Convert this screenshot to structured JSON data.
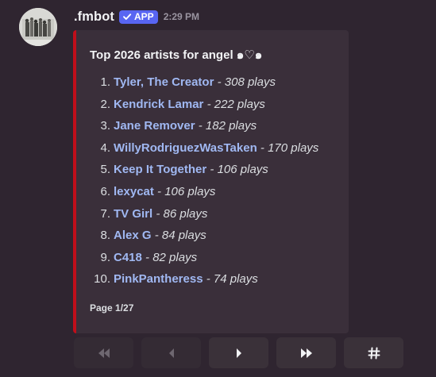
{
  "message": {
    "username": ".fmbot",
    "badge": "APP",
    "timestamp": "2:29 PM"
  },
  "embed": {
    "accent_color": "#c00e1a",
    "title": "Top 2026 artists for angel ๑♡๑",
    "artists": [
      {
        "rank": "1.",
        "name": "Tyler, The Creator",
        "plays": "- 308 plays"
      },
      {
        "rank": "2.",
        "name": "Kendrick Lamar",
        "plays": "- 222 plays"
      },
      {
        "rank": "3.",
        "name": "Jane Remover",
        "plays": "- 182 plays"
      },
      {
        "rank": "4.",
        "name": "WillyRodriguezWasTaken",
        "plays": "- 170 plays"
      },
      {
        "rank": "5.",
        "name": "Keep It Together",
        "plays": "- 106 plays"
      },
      {
        "rank": "6.",
        "name": "lexycat",
        "plays": "- 106 plays"
      },
      {
        "rank": "7.",
        "name": "TV Girl",
        "plays": "- 86 plays"
      },
      {
        "rank": "8.",
        "name": "Alex G",
        "plays": "- 84 plays"
      },
      {
        "rank": "9.",
        "name": "C418",
        "plays": "- 82 plays"
      },
      {
        "rank": "10.",
        "name": "PinkPantheress",
        "plays": "- 74 plays"
      }
    ],
    "footer": "Page 1/27"
  },
  "buttons": [
    {
      "icon": "first-page-icon",
      "disabled": true
    },
    {
      "icon": "previous-page-icon",
      "disabled": true
    },
    {
      "icon": "next-page-icon",
      "disabled": false
    },
    {
      "icon": "last-page-icon",
      "disabled": false
    },
    {
      "icon": "jump-to-page-icon",
      "disabled": false
    }
  ],
  "colors": {
    "background": "#2f2530",
    "embed_background": "#3a2f3a",
    "link": "#a0b8f2",
    "badge": "#5865f2"
  }
}
